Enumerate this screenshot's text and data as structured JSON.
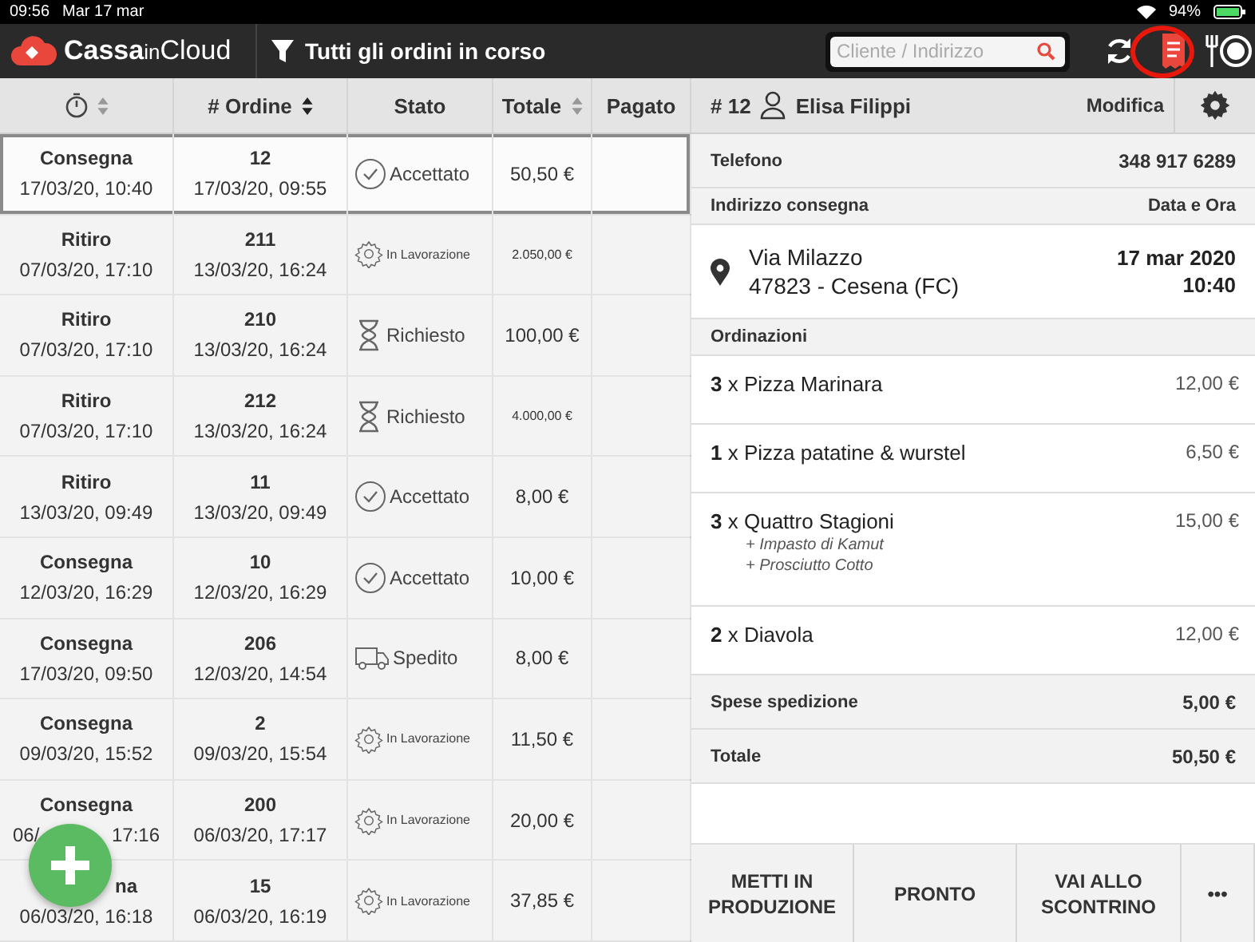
{
  "status_bar": {
    "time": "09:56",
    "date": "Mar 17 mar",
    "battery": "94%"
  },
  "toolbar": {
    "brand_first": "Cassa",
    "brand_second": "in",
    "brand_third": "Cloud",
    "filter": "Tutti gli ordini in corso",
    "search_placeholder": "Cliente / Indirizzo"
  },
  "table": {
    "columns": [
      {
        "kind": "timer",
        "sortable": true
      },
      {
        "label": "# Ordine",
        "kind": "text",
        "sortable": true
      },
      {
        "label": "Stato",
        "kind": "text",
        "sortable": false
      },
      {
        "label": "Totale",
        "kind": "text",
        "sortable": true
      },
      {
        "label": "Pagato",
        "kind": "text",
        "sortable": false
      }
    ],
    "rows": [
      {
        "type": "Consegna",
        "due": "17/03/20, 10:40",
        "number": "12",
        "created": "17/03/20, 09:55",
        "kind": "accepted",
        "status": "Accettato",
        "total": "50,50 €",
        "selected": true
      },
      {
        "type": "Ritiro",
        "due": "07/03/20, 17:10",
        "number": "211",
        "created": "13/03/20, 16:24",
        "kind": "processing",
        "status": "In Lavorazione",
        "total": "2.050,00 €",
        "selected": false
      },
      {
        "type": "Ritiro",
        "due": "07/03/20, 17:10",
        "number": "210",
        "created": "13/03/20, 16:24",
        "kind": "requested",
        "status": "Richiesto",
        "total": "100,00 €",
        "selected": false
      },
      {
        "type": "Ritiro",
        "due": "07/03/20, 17:10",
        "number": "212",
        "created": "13/03/20, 16:24",
        "kind": "requested",
        "status": "Richiesto",
        "total": "4.000,00 €",
        "selected": false
      },
      {
        "type": "Ritiro",
        "due": "13/03/20, 09:49",
        "number": "11",
        "created": "13/03/20, 09:49",
        "kind": "accepted",
        "status": "Accettato",
        "total": "8,00 €",
        "selected": false
      },
      {
        "type": "Consegna",
        "due": "12/03/20, 16:29",
        "number": "10",
        "created": "12/03/20, 16:29",
        "kind": "accepted",
        "status": "Accettato",
        "total": "10,00 €",
        "selected": false
      },
      {
        "type": "Consegna",
        "due": "17/03/20, 09:50",
        "number": "206",
        "created": "12/03/20, 14:54",
        "kind": "shipped",
        "status": "Spedito",
        "total": "8,00 €",
        "selected": false
      },
      {
        "type": "Consegna",
        "due": "09/03/20, 15:52",
        "number": "2",
        "created": "09/03/20, 15:54",
        "kind": "processing",
        "status": "In Lavorazione",
        "total": "11,50 €",
        "selected": false
      },
      {
        "type": "Consegna",
        "due_parts": [
          "06/",
          "17:16"
        ],
        "number": "200",
        "created": "06/03/20, 17:17",
        "kind": "processing",
        "status": "In Lavorazione",
        "total": "20,00 €",
        "selected": false
      },
      {
        "type_parts": [
          "na"
        ],
        "due": "06/03/20, 16:18",
        "number": "15",
        "created": "06/03/20, 16:19",
        "kind": "processing",
        "status": "In Lavorazione",
        "total": "37,85 €",
        "selected": false
      }
    ]
  },
  "detail": {
    "order": "# 12",
    "customer": "Elisa Filippi",
    "edit": "Modifica",
    "phone_label": "Telefono",
    "phone": "348 917 6289",
    "address_label": "Indirizzo consegna",
    "datetime_label": "Data e Ora",
    "street": "Via Milazzo",
    "city": "47823 - Cesena (FC)",
    "date": "17 mar 2020",
    "time": "10:40",
    "orders_label": "Ordinazioni",
    "items": [
      {
        "qty": "3",
        "name": "x Pizza Marinara",
        "price": "12,00 €"
      },
      {
        "qty": "1",
        "name": "x Pizza patatine & wurstel",
        "price": "6,50 €"
      },
      {
        "qty": "3",
        "name": "x Quattro Stagioni",
        "price": "15,00 €",
        "extras": [
          "+ Impasto di Kamut",
          "+ Prosciutto Cotto"
        ]
      },
      {
        "qty": "2",
        "name": "x Diavola",
        "price": "12,00 €"
      }
    ],
    "summary": [
      {
        "label": "Spese spedizione",
        "value": "5,00 €"
      },
      {
        "label": "Totale",
        "value": "50,50 €"
      }
    ],
    "actions": [
      "METTI IN PRODUZIONE",
      "PRONTO",
      "VAI ALLO SCONTRINO",
      "•••"
    ]
  }
}
